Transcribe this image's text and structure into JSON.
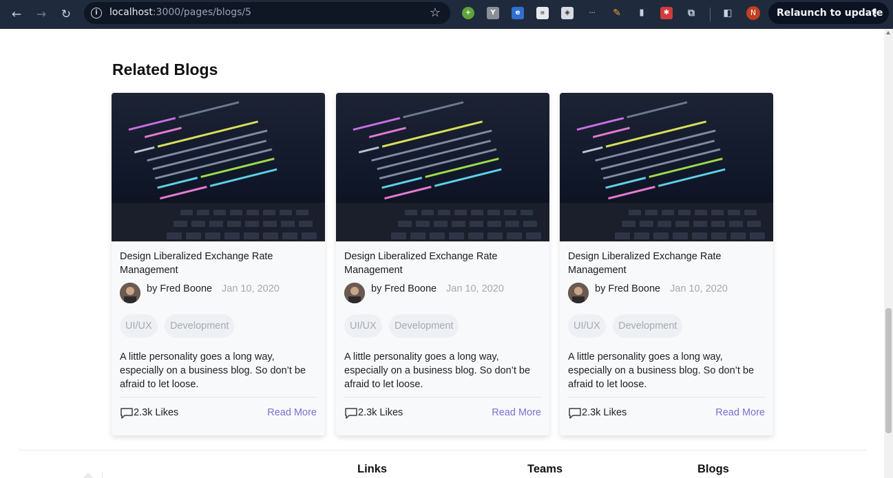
{
  "browser": {
    "url_host": "localhost",
    "url_path": ":3000/pages/blogs/5",
    "profile_initial": "N",
    "relaunch_label": "Relaunch to update"
  },
  "section": {
    "title": "Related Blogs"
  },
  "cards": [
    {
      "title": "Design Liberalized Exchange Rate Management",
      "author": "by Fred Boone",
      "date": "Jan 10, 2020",
      "tags": [
        "UI/UX",
        "Development"
      ],
      "excerpt": "A little personality goes a long way, especially on a business blog. So don’t be afraid to let loose.",
      "likes": "2.3k Likes",
      "read_more": "Read More"
    },
    {
      "title": "Design Liberalized Exchange Rate Management",
      "author": "by Fred Boone",
      "date": "Jan 10, 2020",
      "tags": [
        "UI/UX",
        "Development"
      ],
      "excerpt": "A little personality goes a long way, especially on a business blog. So don’t be afraid to let loose.",
      "likes": "2.3k Likes",
      "read_more": "Read More"
    },
    {
      "title": "Design Liberalized Exchange Rate Management",
      "author": "by Fred Boone",
      "date": "Jan 10, 2020",
      "tags": [
        "UI/UX",
        "Development"
      ],
      "excerpt": "A little personality goes a long way, especially on a business blog. So don’t be afraid to let loose.",
      "likes": "2.3k Likes",
      "read_more": "Read More"
    }
  ],
  "footer": {
    "links_heading": "Links",
    "teams_heading": "Teams",
    "blogs_heading": "Blogs"
  },
  "colors": {
    "chrome_bg": "#1f2a3d",
    "accent_link": "#7b6fd4",
    "card_bg": "#f8f9fb"
  }
}
